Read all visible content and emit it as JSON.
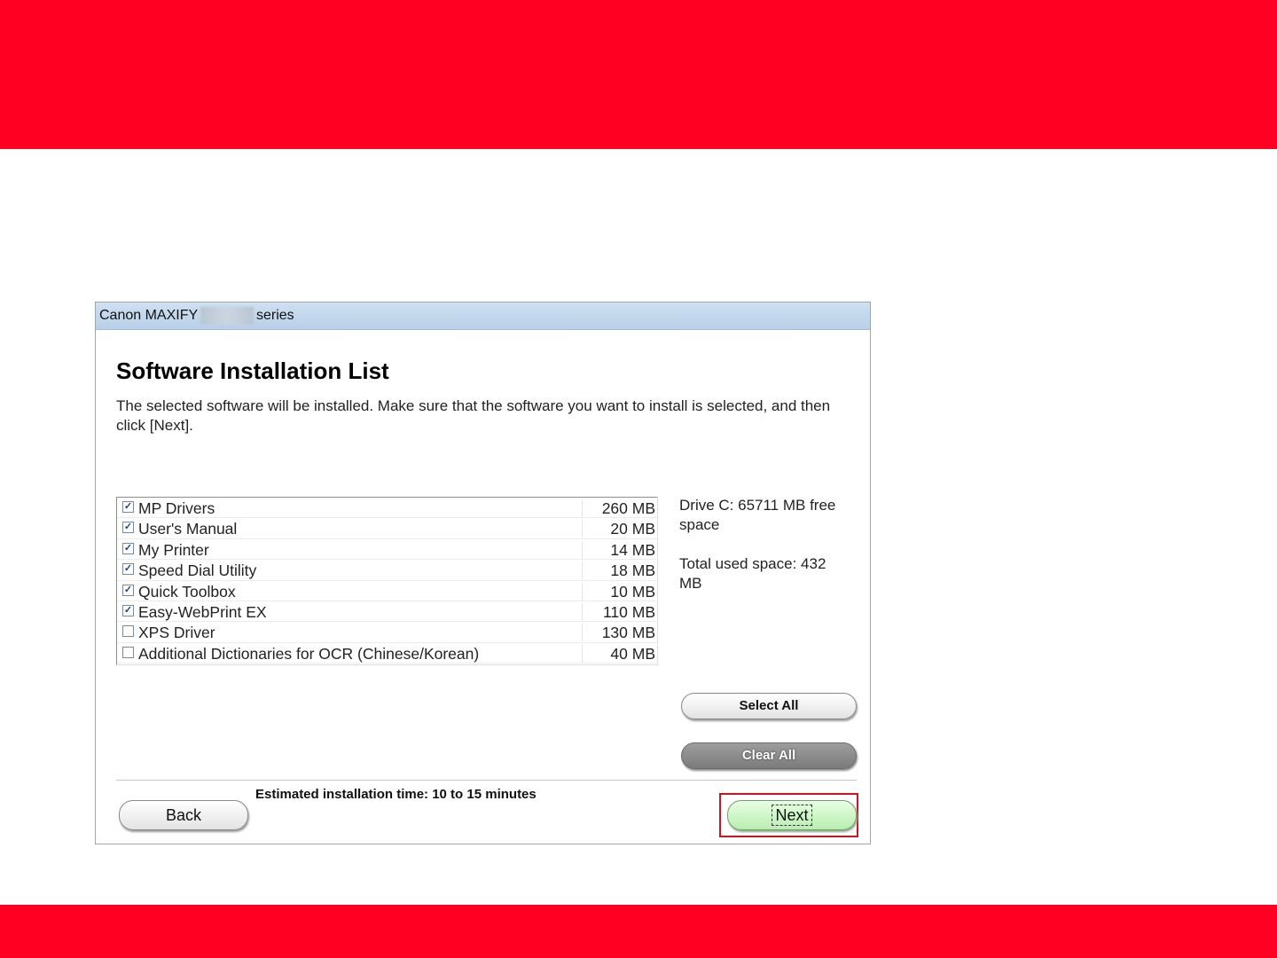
{
  "colors": {
    "brand_red": "#ff0022",
    "highlight_red": "#d0141f",
    "next_green": "#c9f2c2"
  },
  "window": {
    "title_prefix": "Canon MAXIFY",
    "title_suffix": "series"
  },
  "dialog": {
    "heading": "Software Installation List",
    "description": "The selected software will be installed. Make sure that the software you want to install is selected, and then click [Next]."
  },
  "software_list": {
    "items": [
      {
        "name": "MP Drivers",
        "size": "260 MB",
        "checked": true
      },
      {
        "name": "User's Manual",
        "size": "20 MB",
        "checked": true
      },
      {
        "name": "My Printer",
        "size": "14 MB",
        "checked": true
      },
      {
        "name": "Speed Dial Utility",
        "size": "18 MB",
        "checked": true
      },
      {
        "name": "Quick Toolbox",
        "size": "10 MB",
        "checked": true
      },
      {
        "name": "Easy-WebPrint EX",
        "size": "110 MB",
        "checked": true
      },
      {
        "name": "XPS Driver",
        "size": "130 MB",
        "checked": false
      },
      {
        "name": "Additional Dictionaries for OCR (Chinese/Korean)",
        "size": "40 MB",
        "checked": false
      }
    ]
  },
  "space": {
    "free": "Drive C: 65711 MB free space",
    "used": "Total used space: 432 MB"
  },
  "buttons": {
    "select_all": "Select All",
    "clear_all": "Clear All",
    "back": "Back",
    "next": "Next"
  },
  "footer": {
    "estimate": "Estimated installation time: 10 to 15 minutes"
  }
}
